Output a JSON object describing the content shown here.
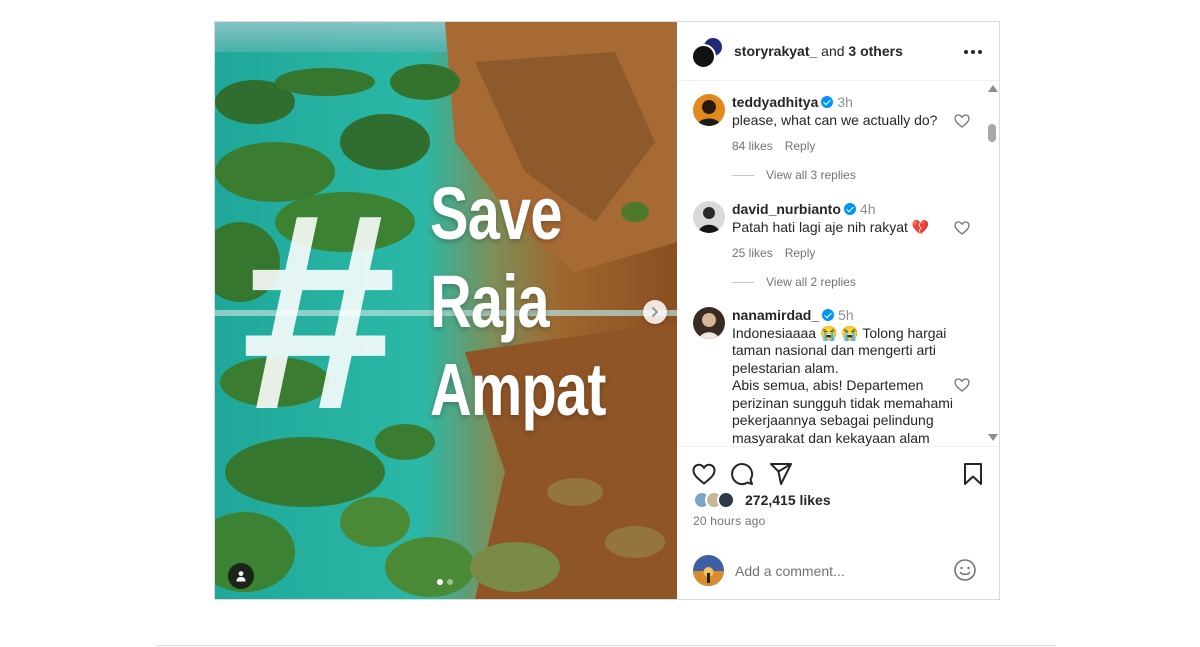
{
  "post": {
    "image_overlay": {
      "hash": "#",
      "words": [
        "Save",
        "Raja",
        "Ampat"
      ]
    },
    "carousel": {
      "current": 1,
      "total": 2
    },
    "header": {
      "username": "storyrakyat_",
      "and_text": " and ",
      "others": "3 others"
    },
    "comments": [
      {
        "username": "teddyadhitya",
        "verified": true,
        "time": "3h",
        "text": "please, what can we actually do?",
        "likes": "84 likes",
        "reply": "Reply",
        "view_replies": "View all 3 replies"
      },
      {
        "username": "david_nurbianto",
        "verified": true,
        "time": "4h",
        "text": "Patah hati lagi aje nih rakyat 💔",
        "likes": "25 likes",
        "reply": "Reply",
        "view_replies": "View all 2 replies"
      },
      {
        "username": "nanamirdad_",
        "verified": true,
        "time": "5h",
        "text_lines": [
          "Indonesiaaaa 😭 😭 Tolong hargai",
          "taman nasional dan mengerti arti",
          "pelestarian alam.",
          "Abis semua, abis! Departemen",
          "perizinan sungguh tidak memahami",
          "pekerjaannya sebagai pelindung",
          "masyarakat dan kekayaan alam kita."
        ]
      }
    ],
    "likes": "272,415 likes",
    "time_ago": "20 hours ago",
    "add_comment_placeholder": "Add a comment...",
    "icons": [
      "heart-icon",
      "comment-icon",
      "share-icon",
      "bookmark-icon",
      "emoji-icon",
      "more-icon",
      "chevron-right-icon",
      "tag-user-icon"
    ],
    "colors": {
      "verified": "#0095f6",
      "muted": "#737373",
      "border": "#dbdbdb"
    }
  }
}
